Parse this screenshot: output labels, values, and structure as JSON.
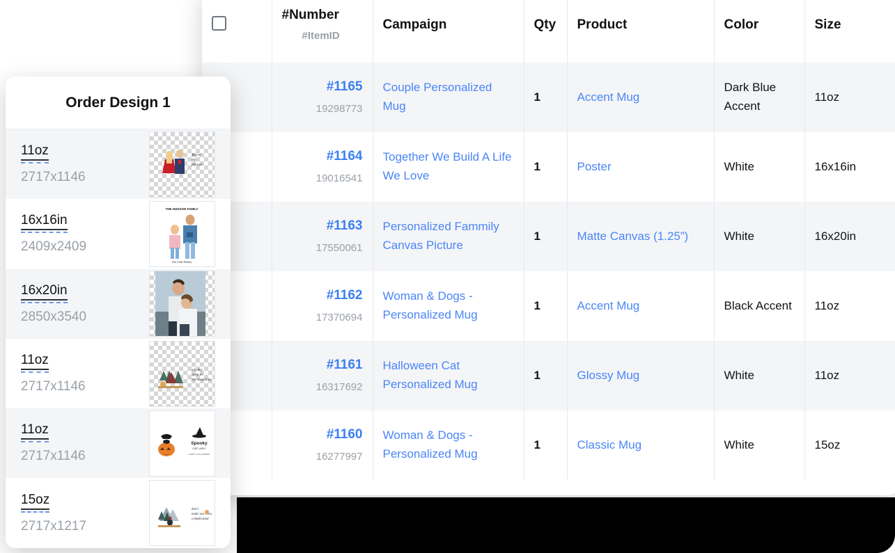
{
  "sidebar": {
    "title": "Order Design 1",
    "rows": [
      {
        "size": "11oz",
        "dimensions": "2717x1146",
        "thumb": "couple-mug-design",
        "transparent": true
      },
      {
        "size": "16x16in",
        "dimensions": "2409x2409",
        "thumb": "hudson-family-poster",
        "transparent": false
      },
      {
        "size": "16x20in",
        "dimensions": "2850x3540",
        "thumb": "couple-photo-canvas",
        "transparent": true
      },
      {
        "size": "11oz",
        "dimensions": "2717x1146",
        "thumb": "camping-mug-design",
        "transparent": true
      },
      {
        "size": "11oz",
        "dimensions": "2717x1146",
        "thumb": "halloween-cat-mug-design",
        "transparent": false
      },
      {
        "size": "15oz",
        "dimensions": "2717x1217",
        "thumb": "mountain-mug-design",
        "transparent": false
      }
    ]
  },
  "table": {
    "headers": {
      "select_all": "",
      "number_primary": "#Number",
      "number_secondary": "#ItemID",
      "campaign": "Campaign",
      "qty": "Qty",
      "product": "Product",
      "color": "Color",
      "size": "Size"
    },
    "rows": [
      {
        "number": "#1165",
        "item_id": "19298773",
        "campaign": "Couple Personalized  Mug",
        "qty": "1",
        "product": "Accent Mug",
        "color": "Dark Blue Accent",
        "size": "11oz"
      },
      {
        "number": "#1164",
        "item_id": "19016541",
        "campaign": "Together We Build A Life We Love",
        "qty": "1",
        "product": "Poster",
        "color": "White",
        "size": "16x16in"
      },
      {
        "number": "#1163",
        "item_id": "17550061",
        "campaign": "Personalized Fammily Canvas Picture",
        "qty": "1",
        "product": "Matte Canvas (1.25”)",
        "color": "White",
        "size": "16x20in"
      },
      {
        "number": "#1162",
        "item_id": "17370694",
        "campaign": "Woman & Dogs - Personalized Mug",
        "qty": "1",
        "product": "Accent Mug",
        "color": "Black Accent",
        "size": "11oz"
      },
      {
        "number": "#1161",
        "item_id": "16317692",
        "campaign": "Halloween Cat Personalized Mug",
        "qty": "1",
        "product": "Glossy Mug",
        "color": "White",
        "size": "11oz"
      },
      {
        "number": "#1160",
        "item_id": "16277997",
        "campaign": "Woman & Dogs - Personalized Mug",
        "qty": "1",
        "product": "Classic Mug",
        "color": "White",
        "size": "15oz"
      }
    ]
  },
  "colors": {
    "link": "#4a86f7",
    "number_link": "#3b7ff0",
    "muted": "#9aa0a8",
    "text": "#111216",
    "row_alt": "#f4f5f7",
    "backdrop": "#000000",
    "dashed_underline": "#6f96e8"
  }
}
